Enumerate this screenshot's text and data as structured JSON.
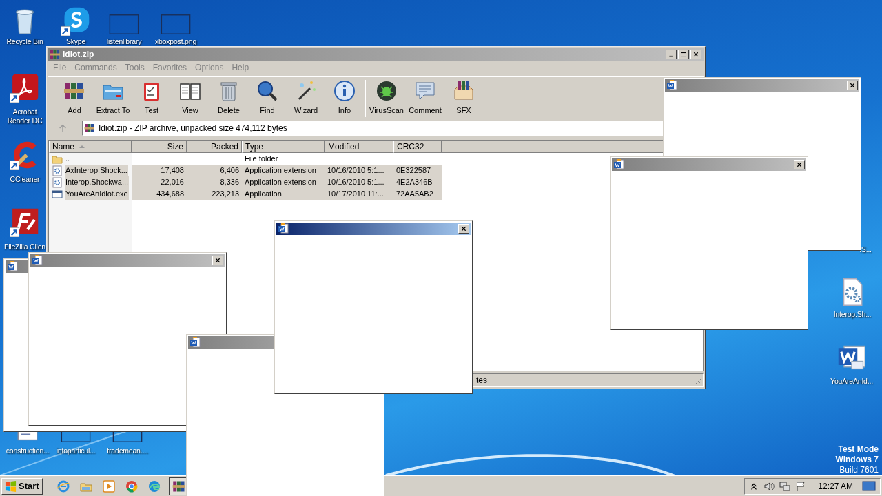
{
  "desktop_icons": [
    {
      "label": "Recycle Bin",
      "kind": "bin",
      "shortcut": false
    },
    {
      "label": "Skype",
      "kind": "skype",
      "shortcut": true
    },
    {
      "label": "listenlibrary",
      "kind": "thumbnail",
      "shortcut": false
    },
    {
      "label": "xboxpost.png",
      "kind": "thumbnail",
      "shortcut": false
    },
    {
      "label": "Acrobat Reader DC",
      "kind": "pdf",
      "shortcut": true
    },
    {
      "label": "CCleaner",
      "kind": "ccleaner",
      "shortcut": true
    },
    {
      "label": "FileZilla Clien",
      "kind": "fz",
      "shortcut": true
    },
    {
      "label": ".S...",
      "kind": "hidden"
    },
    {
      "label": "Interop.Sh...",
      "kind": "geardoc",
      "shortcut": false
    },
    {
      "label": "YouAreAnId...",
      "kind": "word",
      "shortcut": false
    },
    {
      "label": "construction...",
      "kind": "doc",
      "shortcut": false
    },
    {
      "label": "intoparticul...",
      "kind": "thumbnail",
      "shortcut": false
    },
    {
      "label": "trademean....",
      "kind": "thumbnail",
      "shortcut": false
    }
  ],
  "os_notice": [
    {
      "text": "Test Mode",
      "bold": true
    },
    {
      "text": "Windows 7",
      "bold": true
    },
    {
      "text": "Build 7601",
      "bold": false
    }
  ],
  "archive_window": {
    "title": "Idiot.zip",
    "menu": [
      "File",
      "Commands",
      "Tools",
      "Favorites",
      "Options",
      "Help"
    ],
    "toolbar": [
      {
        "label": "Add",
        "kind": "add"
      },
      {
        "label": "Extract To",
        "kind": "extract"
      },
      {
        "label": "Test",
        "kind": "test"
      },
      {
        "label": "View",
        "kind": "view"
      },
      {
        "label": "Delete",
        "kind": "delete"
      },
      {
        "label": "Find",
        "kind": "find"
      },
      {
        "label": "Wizard",
        "kind": "wizard"
      },
      {
        "label": "Info",
        "kind": "info"
      },
      {
        "label": "VirusScan",
        "kind": "virusscan"
      },
      {
        "label": "Comment",
        "kind": "comment"
      },
      {
        "label": "SFX",
        "kind": "sfx"
      }
    ],
    "address": "Idiot.zip - ZIP archive, unpacked size 474,112 bytes",
    "columns": [
      {
        "label": "Name",
        "sorted": true
      },
      {
        "label": "Size",
        "sorted": false
      },
      {
        "label": "Packed",
        "sorted": false
      },
      {
        "label": "Type",
        "sorted": false
      },
      {
        "label": "Modified",
        "sorted": false
      },
      {
        "label": "CRC32",
        "sorted": false
      }
    ],
    "rows": [
      {
        "kind": "folder",
        "name": "..",
        "size": "",
        "packed": "",
        "type": "File folder",
        "modified": "",
        "crc32": "",
        "selected": false
      },
      {
        "kind": "dll",
        "name": "AxInterop.Shock...",
        "size": "17,408",
        "packed": "6,406",
        "type": "Application extension",
        "modified": "10/16/2010 5:1...",
        "crc32": "0E322587",
        "selected": true
      },
      {
        "kind": "dll",
        "name": "Interop.Shockwa...",
        "size": "22,016",
        "packed": "8,336",
        "type": "Application extension",
        "modified": "10/16/2010 5:1...",
        "crc32": "4E2A346B",
        "selected": true
      },
      {
        "kind": "exe",
        "name": "YouAreAnIdiot.exe",
        "size": "434,688",
        "packed": "223,213",
        "type": "Application",
        "modified": "10/17/2010 11:...",
        "crc32": "72AA5AB2",
        "selected": true
      }
    ],
    "status": "tes"
  },
  "popups": [
    {
      "active": false
    },
    {
      "active": false
    },
    {
      "active": false
    },
    {
      "active": false
    },
    {
      "active": false
    },
    {
      "active": true
    }
  ],
  "taskbar": {
    "start": "Start",
    "apps": [
      {
        "kind": "ie",
        "active": false
      },
      {
        "kind": "explorer",
        "active": false
      },
      {
        "kind": "media",
        "active": false
      },
      {
        "kind": "chrome",
        "active": false
      },
      {
        "kind": "edge",
        "active": false
      },
      {
        "kind": "winrar",
        "active": true
      }
    ],
    "time": "12:27 AM"
  }
}
